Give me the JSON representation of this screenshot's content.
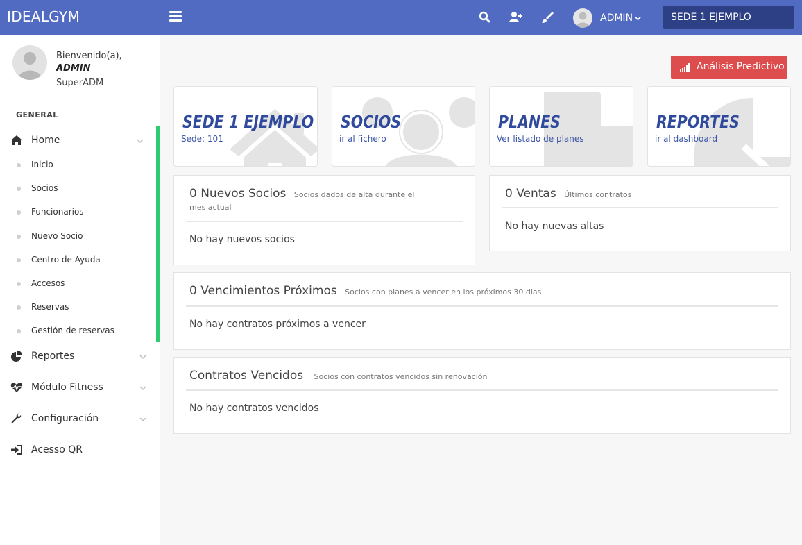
{
  "app": {
    "brand": "IDEALGYM"
  },
  "topbar": {
    "user_name": "ADMIN",
    "sede": "SEDE 1 EJEMPLO"
  },
  "sidebar": {
    "welcome": "Bienvenido(a),",
    "admin_name": "ADMIN",
    "role": "SuperADM",
    "section": "GENERAL",
    "home": "Home",
    "sub_items": [
      "Inicio",
      "Socios",
      "Funcionarios",
      "Nuevo Socio",
      "Centro de Ayuda",
      "Accesos",
      "Reservas",
      "Gestión de reservas"
    ],
    "reportes": "Reportes",
    "fitness": "Módulo Fitness",
    "config": "Configuración",
    "qr": "Acesso QR"
  },
  "main": {
    "predictive_button": "Análisis Predictivo",
    "tiles": [
      {
        "title": "SEDE 1 EJEMPLO",
        "subtitle": "Sede: 101"
      },
      {
        "title": "SOCIOS",
        "subtitle": "ir al fichero"
      },
      {
        "title": "PLANES",
        "subtitle": "Ver listado de planes"
      },
      {
        "title": "REPORTES",
        "subtitle": "ir al dashboard"
      }
    ],
    "nuevos_socios": {
      "title": "0 Nuevos Socios",
      "subtitle": "Socios dados de alta durante el",
      "subtitle2": "mes actual",
      "body": "No hay nuevos socios"
    },
    "ventas": {
      "title": "0 Ventas",
      "subtitle": "Últimos contratos",
      "body": "No hay nuevas altas"
    },
    "vencimientos": {
      "title": "0 Vencimientos Próximos",
      "subtitle": "Socios con planes a vencer en los próximos 30 dias",
      "body": "No hay contratos próximos a vencer"
    },
    "vencidos": {
      "title": "Contratos Vencidos",
      "subtitle": "Socios con contratos vencidos sin renovación",
      "body": "No hay contratos vencidos"
    }
  },
  "colors": {
    "topbar": "#516bc3",
    "sede_select": "#2d3f85",
    "accent_green": "#2ecc71",
    "predictive_button": "#de4d4d",
    "tile_title": "#2f4a9c"
  }
}
